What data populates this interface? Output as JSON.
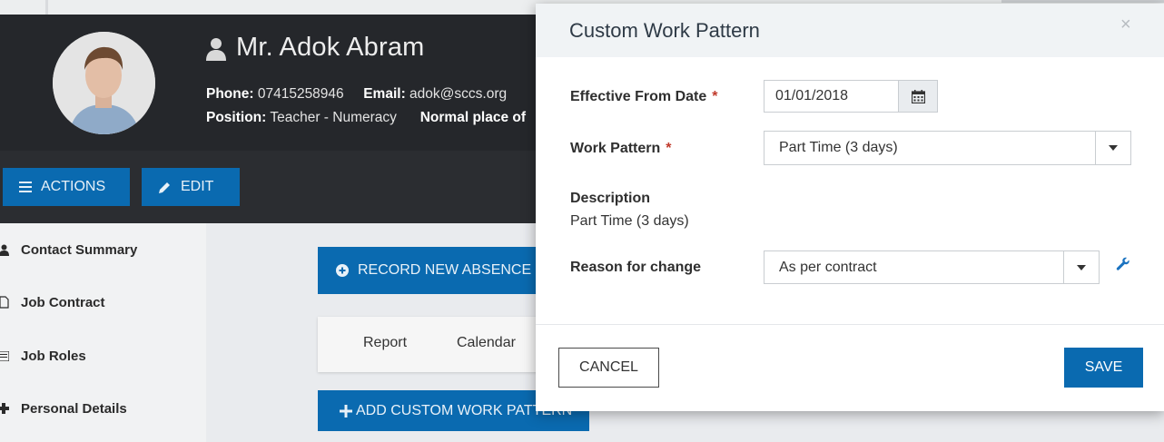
{
  "profile": {
    "name": "Mr. Adok Abram",
    "phone_label": "Phone:",
    "phone": "07415258946",
    "email_label": "Email:",
    "email": "adok@sccs.org",
    "position_label": "Position:",
    "position": "Teacher - Numeracy",
    "place_label": "Normal place of"
  },
  "toolbar": {
    "actions_label": "ACTIONS",
    "edit_label": "EDIT"
  },
  "sidebar": {
    "items": [
      {
        "label": "Contact Summary",
        "icon": "person-icon"
      },
      {
        "label": "Job Contract",
        "icon": "document-icon"
      },
      {
        "label": "Job Roles",
        "icon": "list-icon"
      },
      {
        "label": "Personal Details",
        "icon": "puzzle-icon"
      }
    ]
  },
  "main": {
    "record_absence_label": "RECORD NEW ABSENCE",
    "tabs": [
      {
        "label": "Report"
      },
      {
        "label": "Calendar"
      }
    ],
    "add_pattern_label": "ADD CUSTOM WORK PATTERN"
  },
  "modal": {
    "title": "Custom Work Pattern",
    "close_glyph": "×",
    "effective_date_label": "Effective From Date",
    "effective_date_value": "01/01/2018",
    "work_pattern_label": "Work Pattern",
    "work_pattern_value": "Part Time (3 days)",
    "description_label": "Description",
    "description_value": "Part Time (3 days)",
    "reason_label": "Reason for change",
    "reason_value": "As per contract",
    "required_mark": "*",
    "cancel_label": "CANCEL",
    "save_label": "SAVE"
  },
  "colors": {
    "primary": "#0a6ab0",
    "header_bg": "#25272b",
    "required": "#c0392b"
  }
}
